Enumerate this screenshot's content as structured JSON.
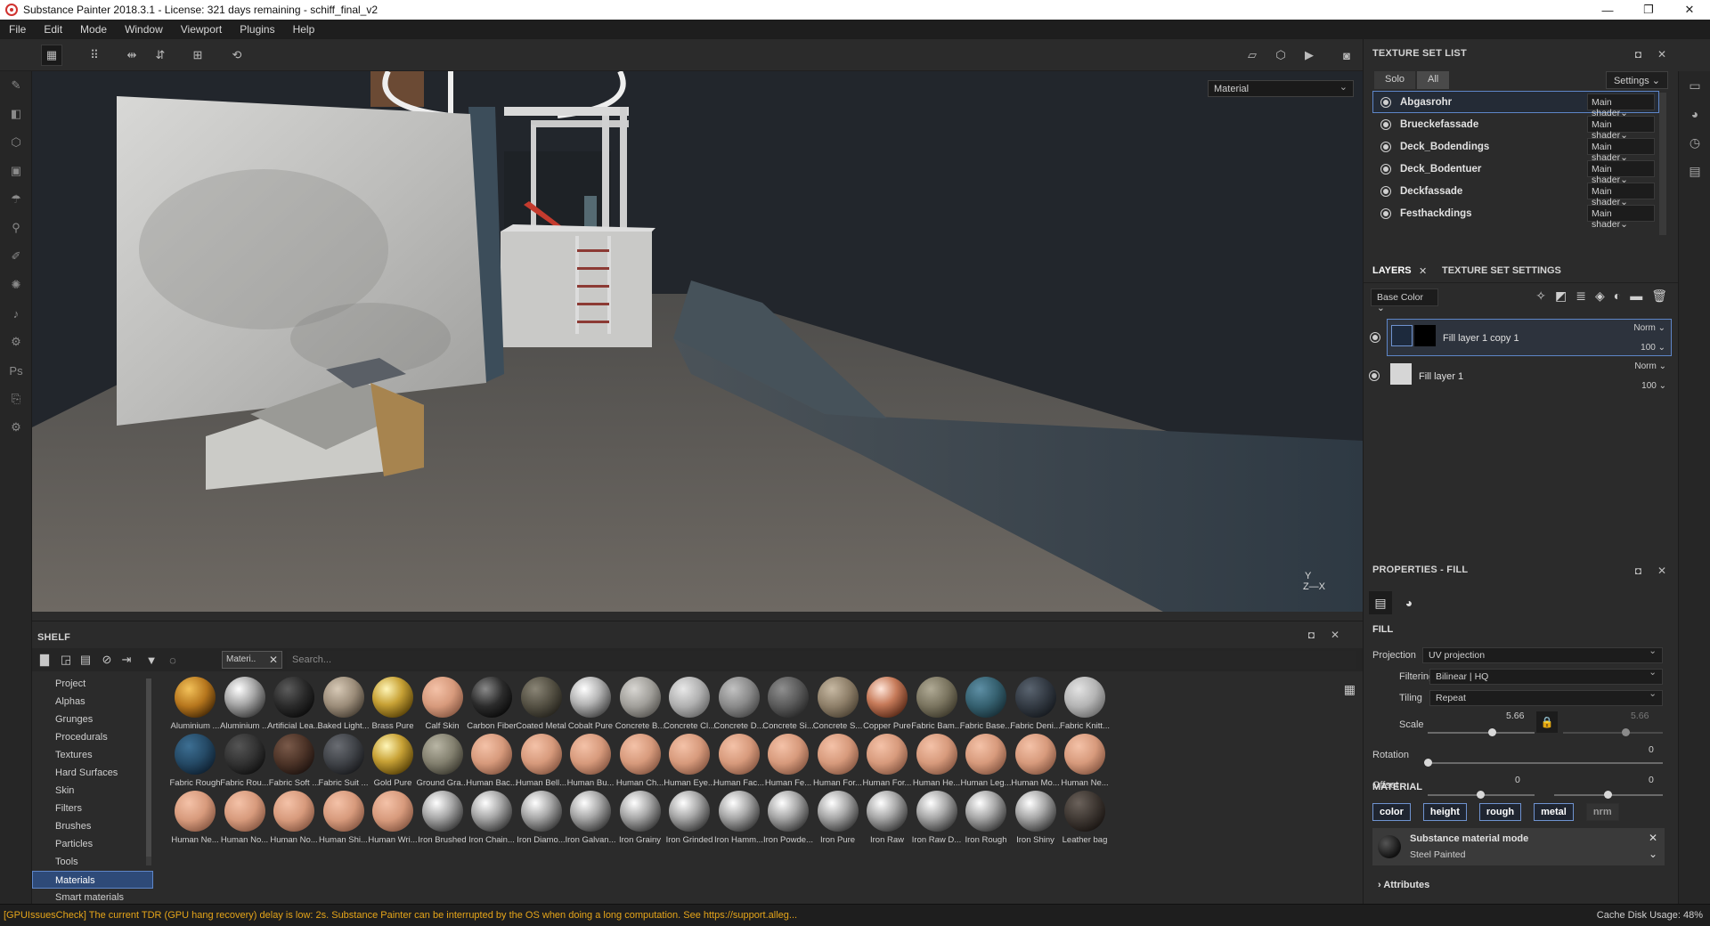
{
  "window": {
    "title": "Substance Painter 2018.3.1 - License: 321 days remaining - schiff_final_v2",
    "minimize": "—",
    "maximize": "❐",
    "close": "✕"
  },
  "menu": [
    "File",
    "Edit",
    "Mode",
    "Window",
    "Viewport",
    "Plugins",
    "Help"
  ],
  "viewport": {
    "mode_select": "Material",
    "axis_y": "Y",
    "axis_zx": "Z—X"
  },
  "shelf": {
    "title": "SHELF",
    "filter_chip": "Materi..",
    "search_placeholder": "Search...",
    "categories": [
      "Project",
      "Alphas",
      "Grunges",
      "Procedurals",
      "Textures",
      "Hard Surfaces",
      "Skin",
      "Filters",
      "Brushes",
      "Particles",
      "Tools",
      "Materials",
      "Smart materials"
    ],
    "selected_category": "Materials",
    "materials": [
      [
        "Aluminium ...",
        "Aluminium ...",
        "Artificial Lea...",
        "Baked Light...",
        "Brass Pure",
        "Calf Skin",
        "Carbon Fiber",
        "Coated Metal",
        "Cobalt Pure",
        "Concrete B...",
        "Concrete Cl...",
        "Concrete D...",
        "Concrete Si...",
        "Concrete S...",
        "Copper Pure",
        "Fabric Bam...",
        "Fabric Base...",
        "Fabric Deni...",
        "Fabric Knitt..."
      ],
      [
        "Fabric Rough",
        "Fabric Rou...",
        "Fabric Soft ...",
        "Fabric Suit ...",
        "Gold Pure",
        "Ground Gra...",
        "Human Bac...",
        "Human Bell...",
        "Human Bu...",
        "Human Ch...",
        "Human Eye...",
        "Human Fac...",
        "Human Fe...",
        "Human For...",
        "Human For...",
        "Human He...",
        "Human Leg...",
        "Human Mo...",
        "Human Ne..."
      ],
      [
        "Human Ne...",
        "Human No...",
        "Human No...",
        "Human Shi...",
        "Human Wri...",
        "Iron Brushed",
        "Iron Chain...",
        "Iron Diamo...",
        "Iron Galvan...",
        "Iron Grainy",
        "Iron Grinded",
        "Iron Hamm...",
        "Iron Powde...",
        "Iron Pure",
        "Iron Raw",
        "Iron Raw D...",
        "Iron Rough",
        "Iron Shiny",
        "Leather bag"
      ]
    ]
  },
  "status": {
    "message": "[GPUIssuesCheck] The current TDR (GPU hang recovery) delay is low: 2s. Substance Painter can be interrupted by the OS when doing a long computation. See https://support.alleg...",
    "cache": "Cache Disk Usage:   48%"
  },
  "texture_set_list": {
    "title": "TEXTURE SET LIST",
    "solo": "Solo",
    "all": "All",
    "settings": "Settings ⌄",
    "items": [
      {
        "name": "Abgasrohr",
        "shader": "Main shader⌄"
      },
      {
        "name": "Brueckefassade",
        "shader": "Main shader⌄"
      },
      {
        "name": "Deck_Bodendings",
        "shader": "Main shader⌄"
      },
      {
        "name": "Deck_Bodentuer",
        "shader": "Main shader⌄"
      },
      {
        "name": "Deckfassade",
        "shader": "Main shader⌄"
      },
      {
        "name": "Festhackdings",
        "shader": "Main shader⌄"
      }
    ]
  },
  "layers": {
    "tab_layers": "LAYERS",
    "tab_close": "✕",
    "tab_settings": "TEXTURE SET SETTINGS",
    "channel": "Base Color ⌄",
    "items": [
      {
        "name": "Fill layer 1 copy 1",
        "blend": "Norm ⌄",
        "opacity": "100 ⌄"
      },
      {
        "name": "Fill layer 1",
        "blend": "Norm ⌄",
        "opacity": "100 ⌄"
      }
    ]
  },
  "properties": {
    "title": "PROPERTIES - FILL",
    "fill_label": "FILL",
    "projection_label": "Projection",
    "projection_value": "UV projection",
    "filtering_label": "Filtering",
    "filtering_value": "Bilinear | HQ",
    "tiling_label": "Tiling",
    "tiling_value": "Repeat",
    "scale_label": "Scale",
    "scale_value": "5.66",
    "scale_value_locked": "5.66",
    "rotation_label": "Rotation",
    "rotation_value": "0",
    "offset_label": "Offset",
    "offset_u": "0",
    "offset_v": "0",
    "material_label": "MATERIAL",
    "channels": [
      "color",
      "height",
      "rough",
      "metal",
      "nrm"
    ],
    "mode_title": "Substance material mode",
    "mode_value": "Steel Painted",
    "attributes_label": "Attributes"
  }
}
